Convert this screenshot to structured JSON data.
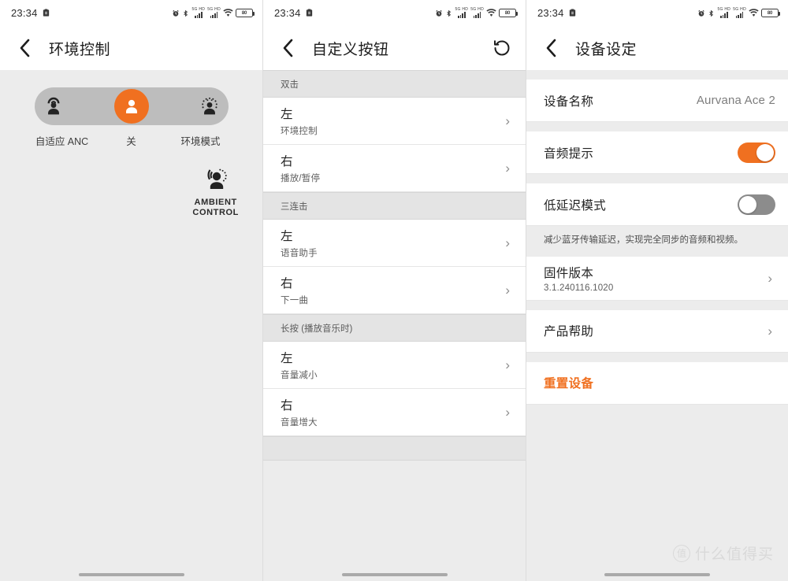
{
  "status_bar": {
    "time": "23:34",
    "icons": [
      "alarm-clock-icon",
      "bluetooth-icon",
      "signal-5g-hd-icon",
      "signal-5g-hd-icon",
      "wifi-icon",
      "battery-icon"
    ],
    "signal_label": "5G HD",
    "battery_label": "80"
  },
  "panel1": {
    "title": "环境控制",
    "back_icon": "chevron-left-icon",
    "anc": {
      "options": [
        {
          "label": "自适应 ANC",
          "icon": "adaptive-anc-icon",
          "active": false
        },
        {
          "label": "关",
          "icon": "anc-off-icon",
          "active": true
        },
        {
          "label": "环境模式",
          "icon": "ambient-mode-icon",
          "active": false
        }
      ]
    },
    "mode_badge": {
      "icon": "ambient-control-icon",
      "line1": "AMBIENT",
      "line2": "CONTROL"
    }
  },
  "panel2": {
    "title": "自定义按钮",
    "back_icon": "chevron-left-icon",
    "reset_icon": "restore-rotate-icon",
    "sections": [
      {
        "header": "双击",
        "rows": [
          {
            "title": "左",
            "sub": "环境控制"
          },
          {
            "title": "右",
            "sub": "播放/暂停"
          }
        ]
      },
      {
        "header": "三连击",
        "rows": [
          {
            "title": "左",
            "sub": "语音助手"
          },
          {
            "title": "右",
            "sub": "下一曲"
          }
        ]
      },
      {
        "header": "长按 (播放音乐时)",
        "rows": [
          {
            "title": "左",
            "sub": "音量减小"
          },
          {
            "title": "右",
            "sub": "音量增大"
          }
        ]
      }
    ]
  },
  "panel3": {
    "title": "设备设定",
    "back_icon": "chevron-left-icon",
    "rows": {
      "device_name_label": "设备名称",
      "device_name_value": "Aurvana Ace 2",
      "audio_prompt_label": "音频提示",
      "audio_prompt_on": true,
      "low_latency_label": "低延迟模式",
      "low_latency_on": false,
      "low_latency_note": "减少蓝牙传输延迟，实现完全同步的音频和视频。",
      "firmware_label": "固件版本",
      "firmware_value": "3.1.240116.1020",
      "product_help_label": "产品帮助",
      "reset_device_label": "重置设备"
    }
  },
  "watermark": {
    "logo_text": "值",
    "text": "什么值得买"
  },
  "colors": {
    "accent": "#f07020",
    "page_bg": "#ececec",
    "card_bg": "#ffffff",
    "section_bg": "#e4e4e4",
    "toggle_off": "#8c8c8c"
  }
}
